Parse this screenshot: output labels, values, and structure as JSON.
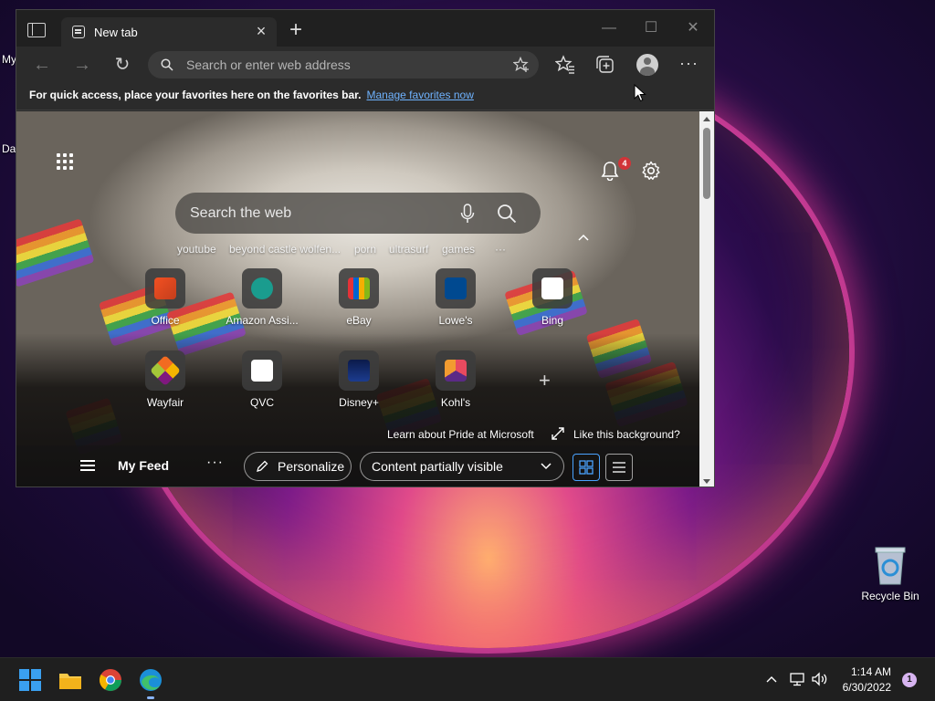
{
  "desktop": {
    "left_label_1": "My",
    "left_label_2": "Da",
    "recycle_bin_label": "Recycle Bin"
  },
  "browser": {
    "tab_title": "New tab",
    "address_placeholder": "Search or enter web address",
    "favorites_bar_text": "For quick access, place your favorites here on the favorites bar.",
    "favorites_bar_link": "Manage favorites now",
    "accent_color": "#6fb3ff"
  },
  "newtab": {
    "notification_count": "4",
    "search_placeholder": "Search the web",
    "suggestions": [
      "youtube",
      "beyond castle wolfen...",
      "porn",
      "ultrasurf",
      "games"
    ],
    "suggestions_more": "···",
    "quick_links": [
      {
        "label": "Office",
        "icon": "office-icon"
      },
      {
        "label": "Amazon Assi...",
        "icon": "amazon-icon"
      },
      {
        "label": "eBay",
        "icon": "ebay-icon"
      },
      {
        "label": "Lowe's",
        "icon": "lowes-icon"
      },
      {
        "label": "Bing",
        "icon": "bing-icon"
      },
      {
        "label": "Wayfair",
        "icon": "wayfair-icon"
      },
      {
        "label": "QVC",
        "icon": "qvc-icon"
      },
      {
        "label": "Disney+",
        "icon": "disney-icon"
      },
      {
        "label": "Kohl's",
        "icon": "kohls-icon"
      }
    ],
    "pride_link": "Learn about Pride at Microsoft",
    "like_background": "Like this background?",
    "feed": {
      "title": "My Feed",
      "more": "···",
      "personalize": "Personalize",
      "content_visibility": "Content partially visible"
    }
  },
  "taskbar": {
    "time": "1:14 AM",
    "date": "6/30/2022",
    "notification_count": "1"
  }
}
